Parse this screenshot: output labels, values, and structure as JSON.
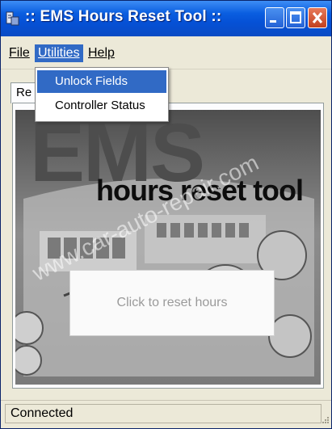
{
  "window": {
    "title": ":: EMS Hours Reset Tool ::",
    "accent_color": "#0a5ee0",
    "title_icon": "app-icon"
  },
  "titlebar_buttons": {
    "minimize_icon": "minimize-icon",
    "maximize_icon": "maximize-icon",
    "close_icon": "close-icon"
  },
  "menu": {
    "file": "File",
    "utilities": "Utilities",
    "help": "Help"
  },
  "utilities_dropdown": {
    "items": [
      "Unlock Fields",
      "Controller Status"
    ],
    "highlight_color": "#316ac5"
  },
  "tab": {
    "label_fragment": "Re"
  },
  "banner": {
    "ems": "EMS",
    "subtitle": "hours reset tool",
    "watermark": "www.car-auto-repair.com"
  },
  "reset_button": {
    "label": "Click to reset hours"
  },
  "status": {
    "text": "Connected"
  }
}
